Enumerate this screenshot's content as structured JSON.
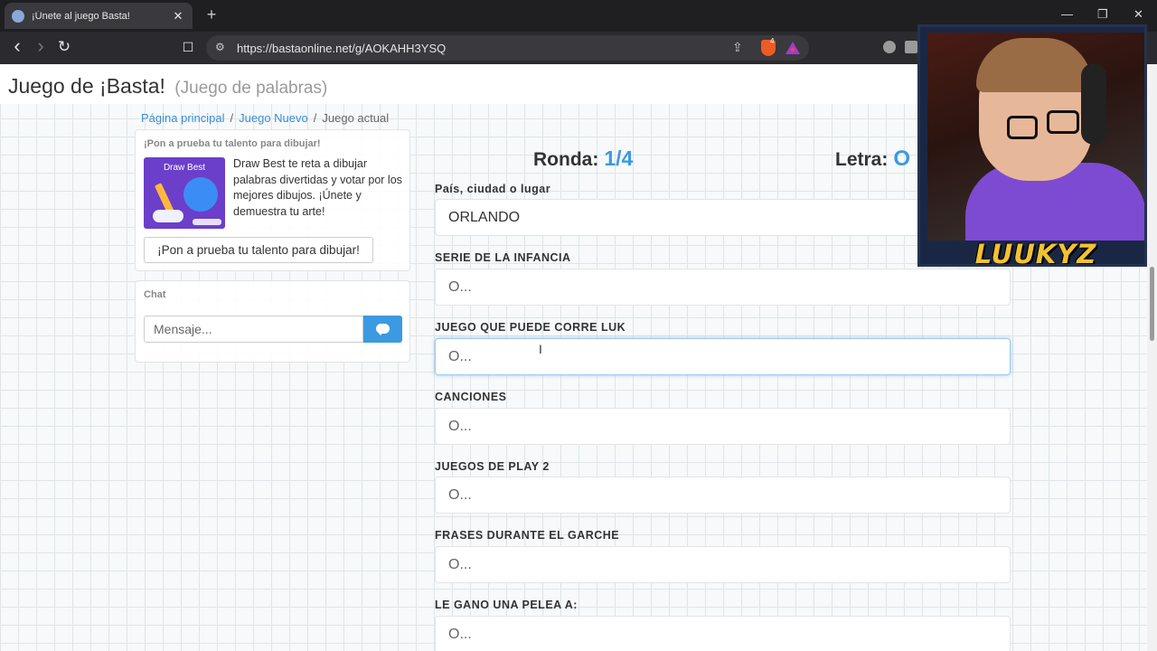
{
  "browser": {
    "tab": {
      "title": "¡Únete al juego Basta!",
      "close": "✕"
    },
    "new_tab": "+",
    "window_controls": {
      "minimize": "—",
      "maximize": "❐",
      "close": "✕"
    },
    "nav": {
      "back": "‹",
      "forward": "›",
      "reload": "↻",
      "bookmark": "☐"
    },
    "url": "https://bastaonline.net/g/AOKAHH3YSQ",
    "brave_badge": "4"
  },
  "header": {
    "title": "Juego de ¡Basta!",
    "subtitle": "(Juego de palabras)"
  },
  "breadcrumb": {
    "home": "Página principal",
    "new_game": "Juego Nuevo",
    "current": "Juego actual",
    "separator": "/"
  },
  "ad": {
    "heading": "¡Pon a prueba tu talento para dibujar!",
    "image_title": "Draw Best",
    "text": "Draw Best te reta a dibujar palabras divertidas y votar por los mejores dibujos. ¡Únete y demuestra tu arte!",
    "button": "¡Pon a prueba tu talento para dibujar!"
  },
  "chat": {
    "heading": "Chat",
    "placeholder": "Mensaje...",
    "send_icon": "comment-icon"
  },
  "game": {
    "round_label": "Ronda:",
    "round_value": "1/4",
    "letter_label": "Letra:",
    "letter_value": "O",
    "fields": [
      {
        "label": "País, ciudad o lugar",
        "value": "ORLANDO",
        "placeholder": "O..."
      },
      {
        "label": "SERIE DE LA INFANCIA",
        "value": "",
        "placeholder": "O..."
      },
      {
        "label": "JUEGO QUE PUEDE CORRE LUK",
        "value": "",
        "placeholder": "O..."
      },
      {
        "label": "CANCIONES",
        "value": "",
        "placeholder": "O..."
      },
      {
        "label": "JUEGOS DE PLAY 2",
        "value": "",
        "placeholder": "O..."
      },
      {
        "label": "FRASES DURANTE EL GARCHE",
        "value": "",
        "placeholder": "O..."
      },
      {
        "label": "LE GANO UNA PELEA A:",
        "value": "",
        "placeholder": "O..."
      }
    ]
  },
  "webcam": {
    "name": "LUUKYZ"
  },
  "colors": {
    "accent": "#3b9ae1",
    "link": "#3a8fd3",
    "brave": "#f05a23"
  }
}
